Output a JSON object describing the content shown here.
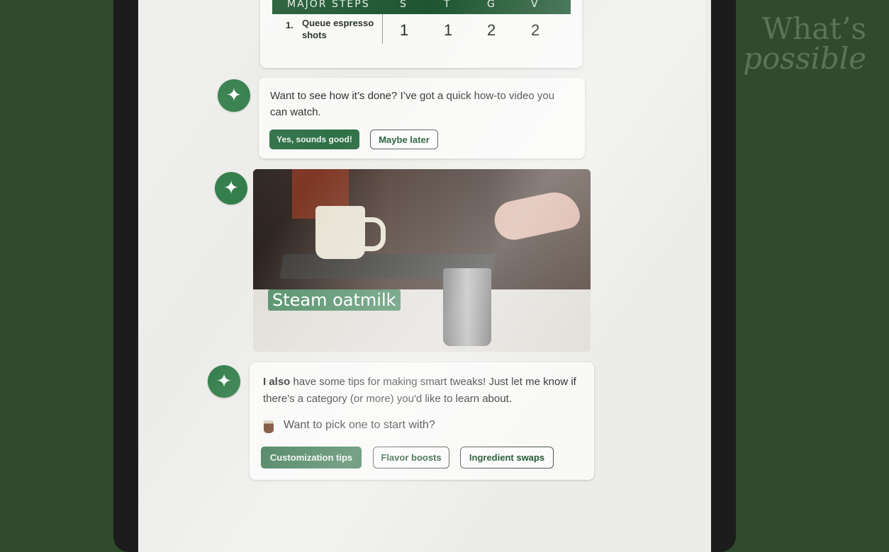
{
  "watermark": {
    "line1": "What’s",
    "line2": "possible"
  },
  "table": {
    "header": {
      "title": "MAJOR STEPS",
      "cols": [
        "S",
        "T",
        "G",
        "V"
      ]
    },
    "rows": [
      {
        "num": "1.",
        "step": "Queue espresso shots",
        "values": [
          "1",
          "1",
          "2",
          "2"
        ]
      }
    ]
  },
  "video_offer": {
    "text": "Want to see how it’s done? I’ve got a quick how-to video you can watch.",
    "btn_yes": "Yes, sounds good!",
    "btn_later": "Maybe later"
  },
  "video": {
    "caption": "Steam oatmilk"
  },
  "tips": {
    "text_bold": "I also",
    "text_rest": " have some tips for making smart tweaks! Just let me know if there's a category (or more) you'd like to learn about.",
    "prompt": "Want to pick one to start with?",
    "chips": [
      "Customization tips",
      "Flavor boosts",
      "Ingredient swaps"
    ]
  },
  "icons": {
    "avatar": "sparkle-icon",
    "prompt": "coffee-cup-icon"
  },
  "colors": {
    "brand_green": "#1e5631",
    "button_green": "#2f7047",
    "background": "#2f4a2c"
  }
}
